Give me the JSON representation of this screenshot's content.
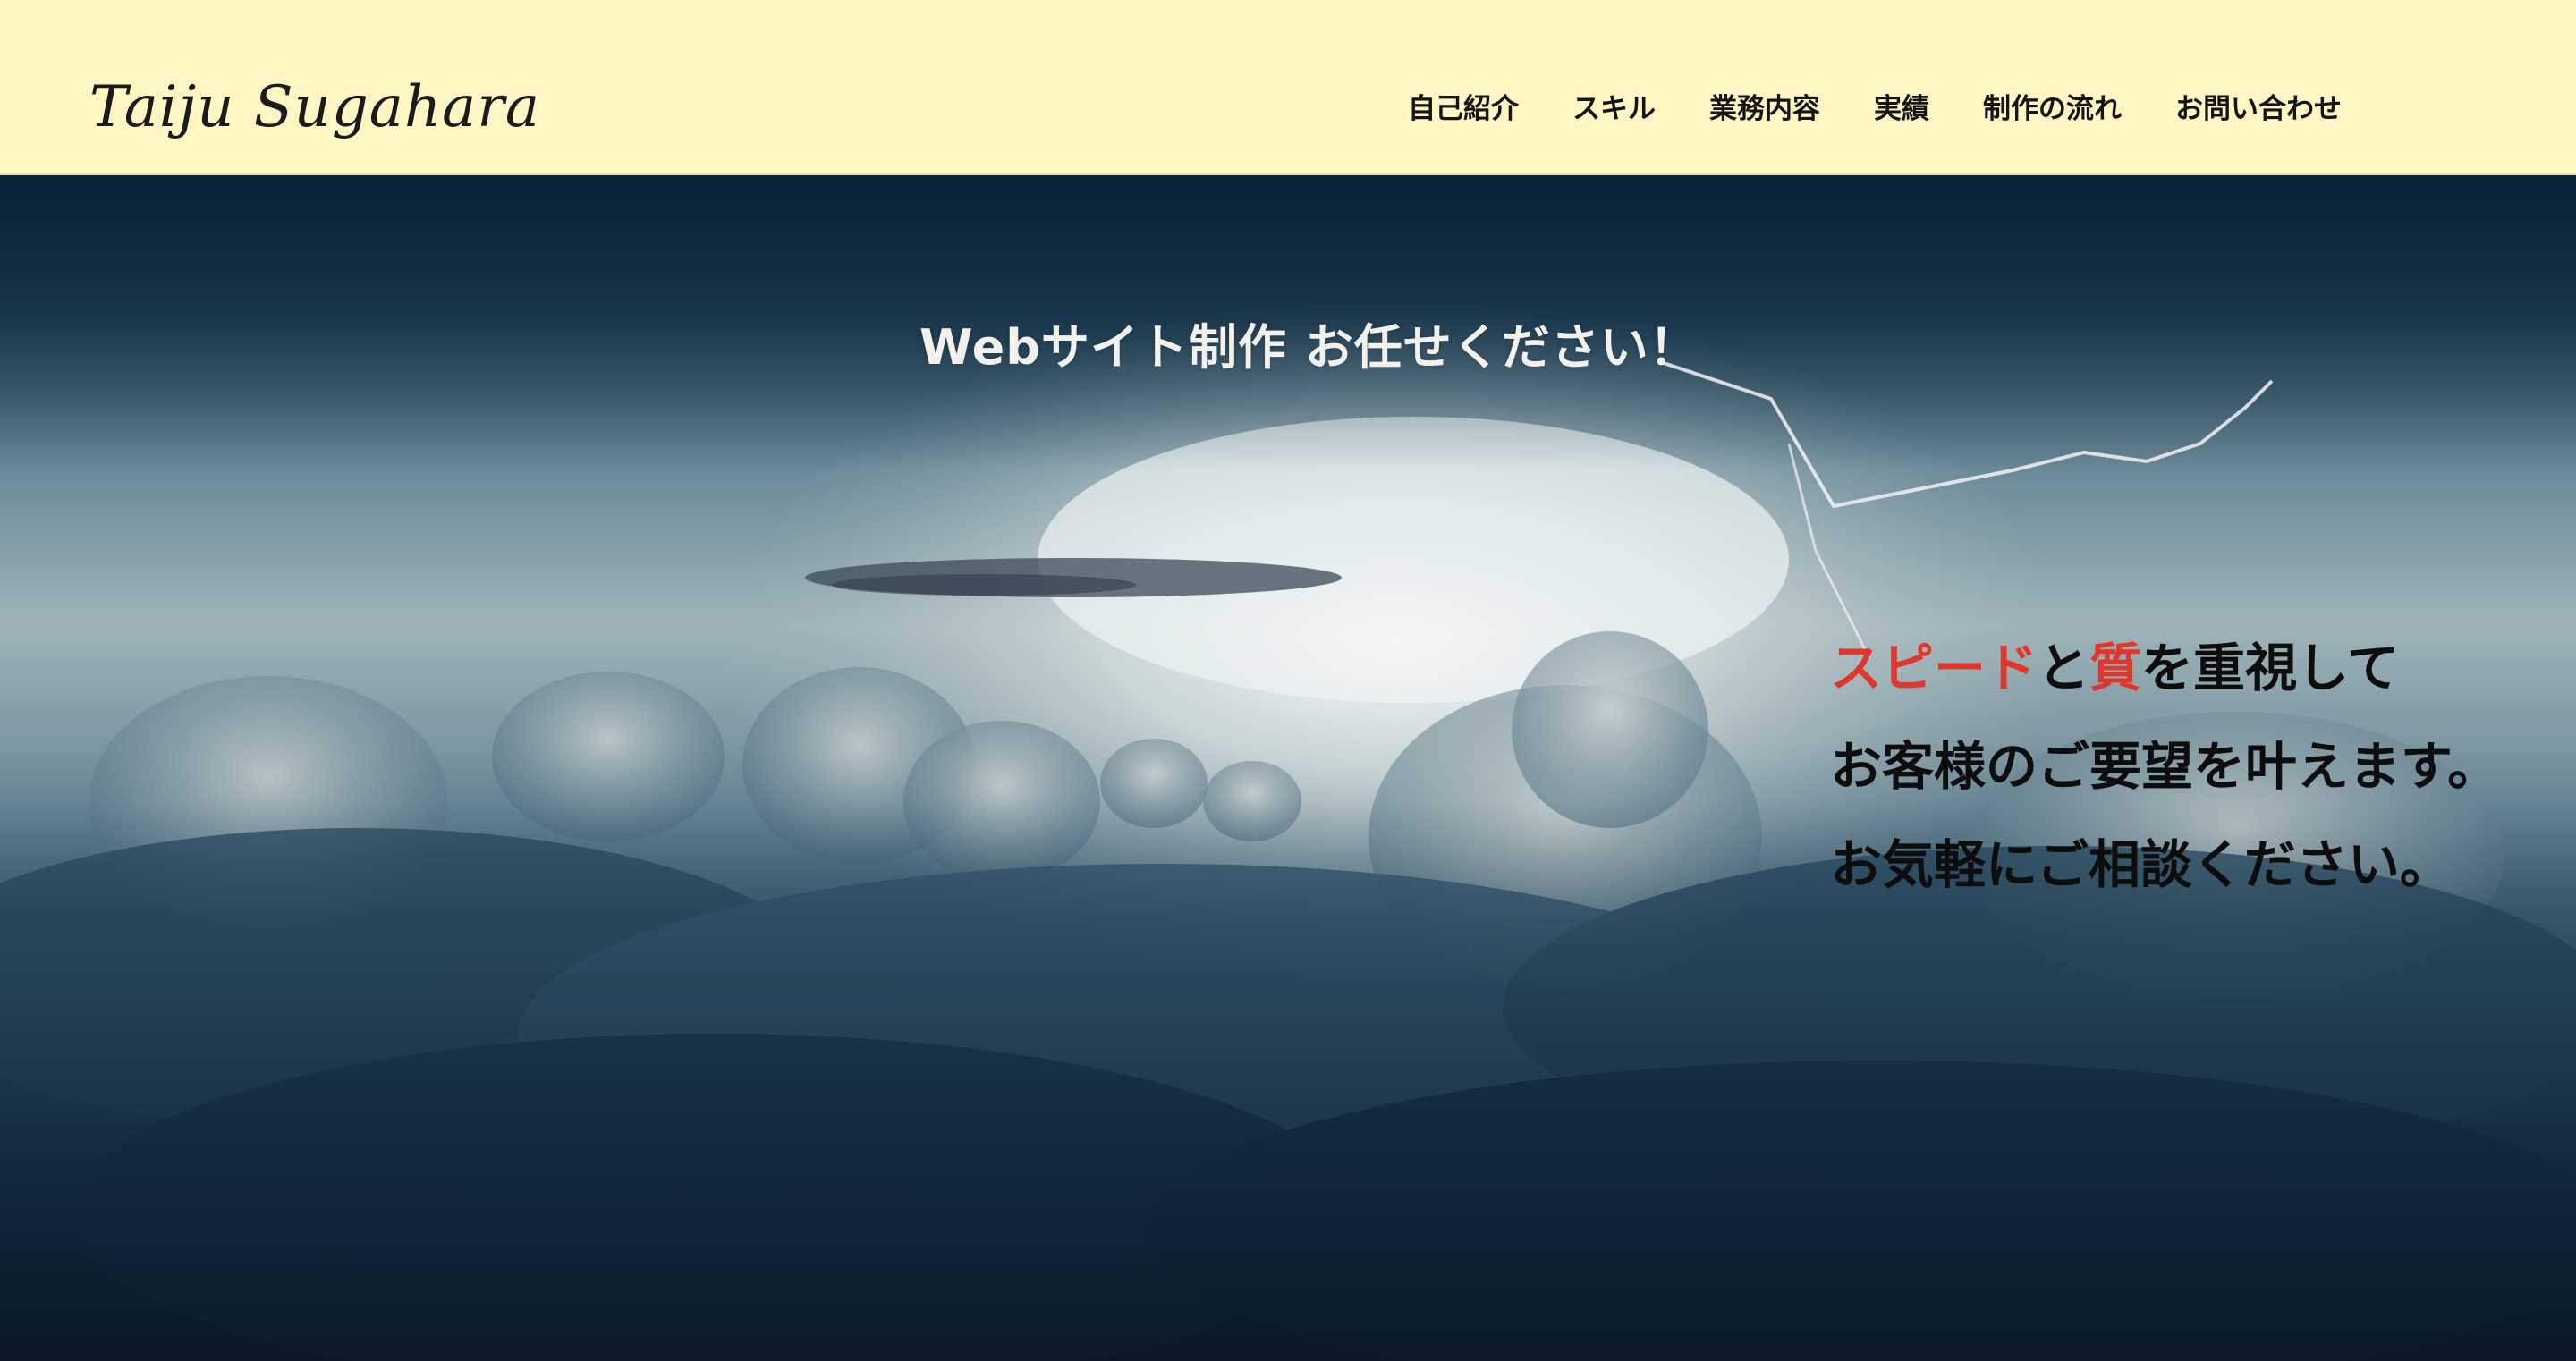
{
  "header": {
    "logo": "Taiju Sugahara",
    "nav": [
      {
        "label": "自己紹介"
      },
      {
        "label": "スキル"
      },
      {
        "label": "業務内容"
      },
      {
        "label": "実績"
      },
      {
        "label": "制作の流れ"
      },
      {
        "label": "お問い合わせ"
      }
    ],
    "background_color": "#fff6c4"
  },
  "hero": {
    "tagline": "Webサイト制作 お任せください！",
    "message": {
      "line1": [
        {
          "text": "スピード",
          "accent": true
        },
        {
          "text": "と",
          "accent": false
        },
        {
          "text": "質",
          "accent": true
        },
        {
          "text": "を重視して",
          "accent": false
        }
      ],
      "line2": "お客様のご要望を叶えます。",
      "line3": "お気軽にご相談ください。"
    },
    "accent_color": "#e0362c",
    "background_image": "storm-clouds-with-lightning"
  }
}
